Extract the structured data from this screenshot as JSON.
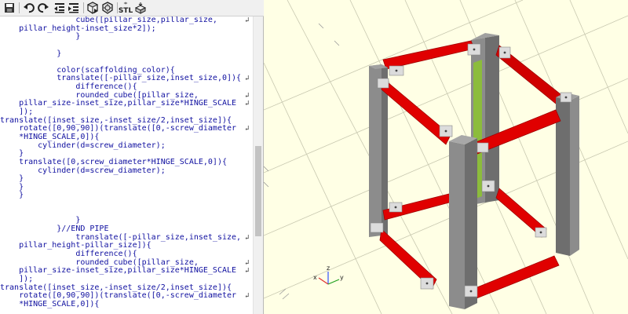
{
  "toolbar": {
    "icons": [
      "save-icon",
      "undo-icon",
      "redo-icon",
      "unindent-icon",
      "indent-icon",
      "preview-icon",
      "render-icon",
      "export-stl-icon",
      "send-to-print-icon"
    ],
    "stl_label": "STL"
  },
  "editor": {
    "lines": [
      {
        "text": "                cube([pillar_size,pillar_size,",
        "wrap": true
      },
      {
        "text": "    pillar_height-inset_size*2]);",
        "wrap": false
      },
      {
        "text": "                }",
        "wrap": false
      },
      {
        "text": "",
        "wrap": false
      },
      {
        "text": "            }",
        "wrap": false
      },
      {
        "text": "",
        "wrap": false
      },
      {
        "text": "            color(scaffolding_color){",
        "wrap": false
      },
      {
        "text": "            translate([-pillar_size,inset_size,0]){",
        "wrap": true
      },
      {
        "text": "                difference(){",
        "wrap": false
      },
      {
        "text": "                rounded_cube([pillar_size,",
        "wrap": true
      },
      {
        "text": "    pillar_size-inset_size,pillar_size*HINGE_SCALE",
        "wrap": true
      },
      {
        "text": "    ]);",
        "wrap": false
      },
      {
        "text": "translate([inset_size,-inset_size/2,inset_size]){",
        "wrap": false
      },
      {
        "text": "    rotate([0,90,90])(translate([0,-screw_diameter",
        "wrap": true
      },
      {
        "text": "    *HINGE_SCALE,0]){",
        "wrap": false
      },
      {
        "text": "        cylinder(d=screw_diameter);",
        "wrap": false
      },
      {
        "text": "    }",
        "wrap": false
      },
      {
        "text": "    translate([0,screw_diameter*HINGE_SCALE,0]){",
        "wrap": false
      },
      {
        "text": "        cylinder(d=screw_diameter);",
        "wrap": false
      },
      {
        "text": "    }",
        "wrap": false
      },
      {
        "text": "    }",
        "wrap": false
      },
      {
        "text": "    }",
        "wrap": false
      },
      {
        "text": "",
        "wrap": false
      },
      {
        "text": "",
        "wrap": false
      },
      {
        "text": "                }",
        "wrap": false
      },
      {
        "text": "            }//END PIPE",
        "wrap": false
      },
      {
        "text": "                translate([-pillar_size,inset_size,",
        "wrap": true
      },
      {
        "text": "    pillar_height-pillar_size]){",
        "wrap": false
      },
      {
        "text": "                difference(){",
        "wrap": false
      },
      {
        "text": "                rounded_cube([pillar_size,",
        "wrap": true
      },
      {
        "text": "    pillar_size-inset_size,pillar_size*HINGE_SCALE",
        "wrap": true
      },
      {
        "text": "    ]);",
        "wrap": false
      },
      {
        "text": "translate([inset_size,-inset_size/2,inset_size]){",
        "wrap": false
      },
      {
        "text": "    rotate([0,90,90])(translate([0,-screw_diameter",
        "wrap": true
      },
      {
        "text": "    *HINGE_SCALE,0]){",
        "wrap": false
      }
    ],
    "wrap_symbol": "↲"
  },
  "viewport": {
    "background": "#ffffe5",
    "model_colors": {
      "pillar": "#6e6e6e",
      "pillar_light": "#8c8c8c",
      "beam": "#e00000",
      "beam_dark": "#b00000",
      "hinge": "#dcdcdc",
      "panel": "#8cbc3c"
    },
    "axis_labels": {
      "x": "x",
      "y": "y",
      "z": "z"
    }
  }
}
